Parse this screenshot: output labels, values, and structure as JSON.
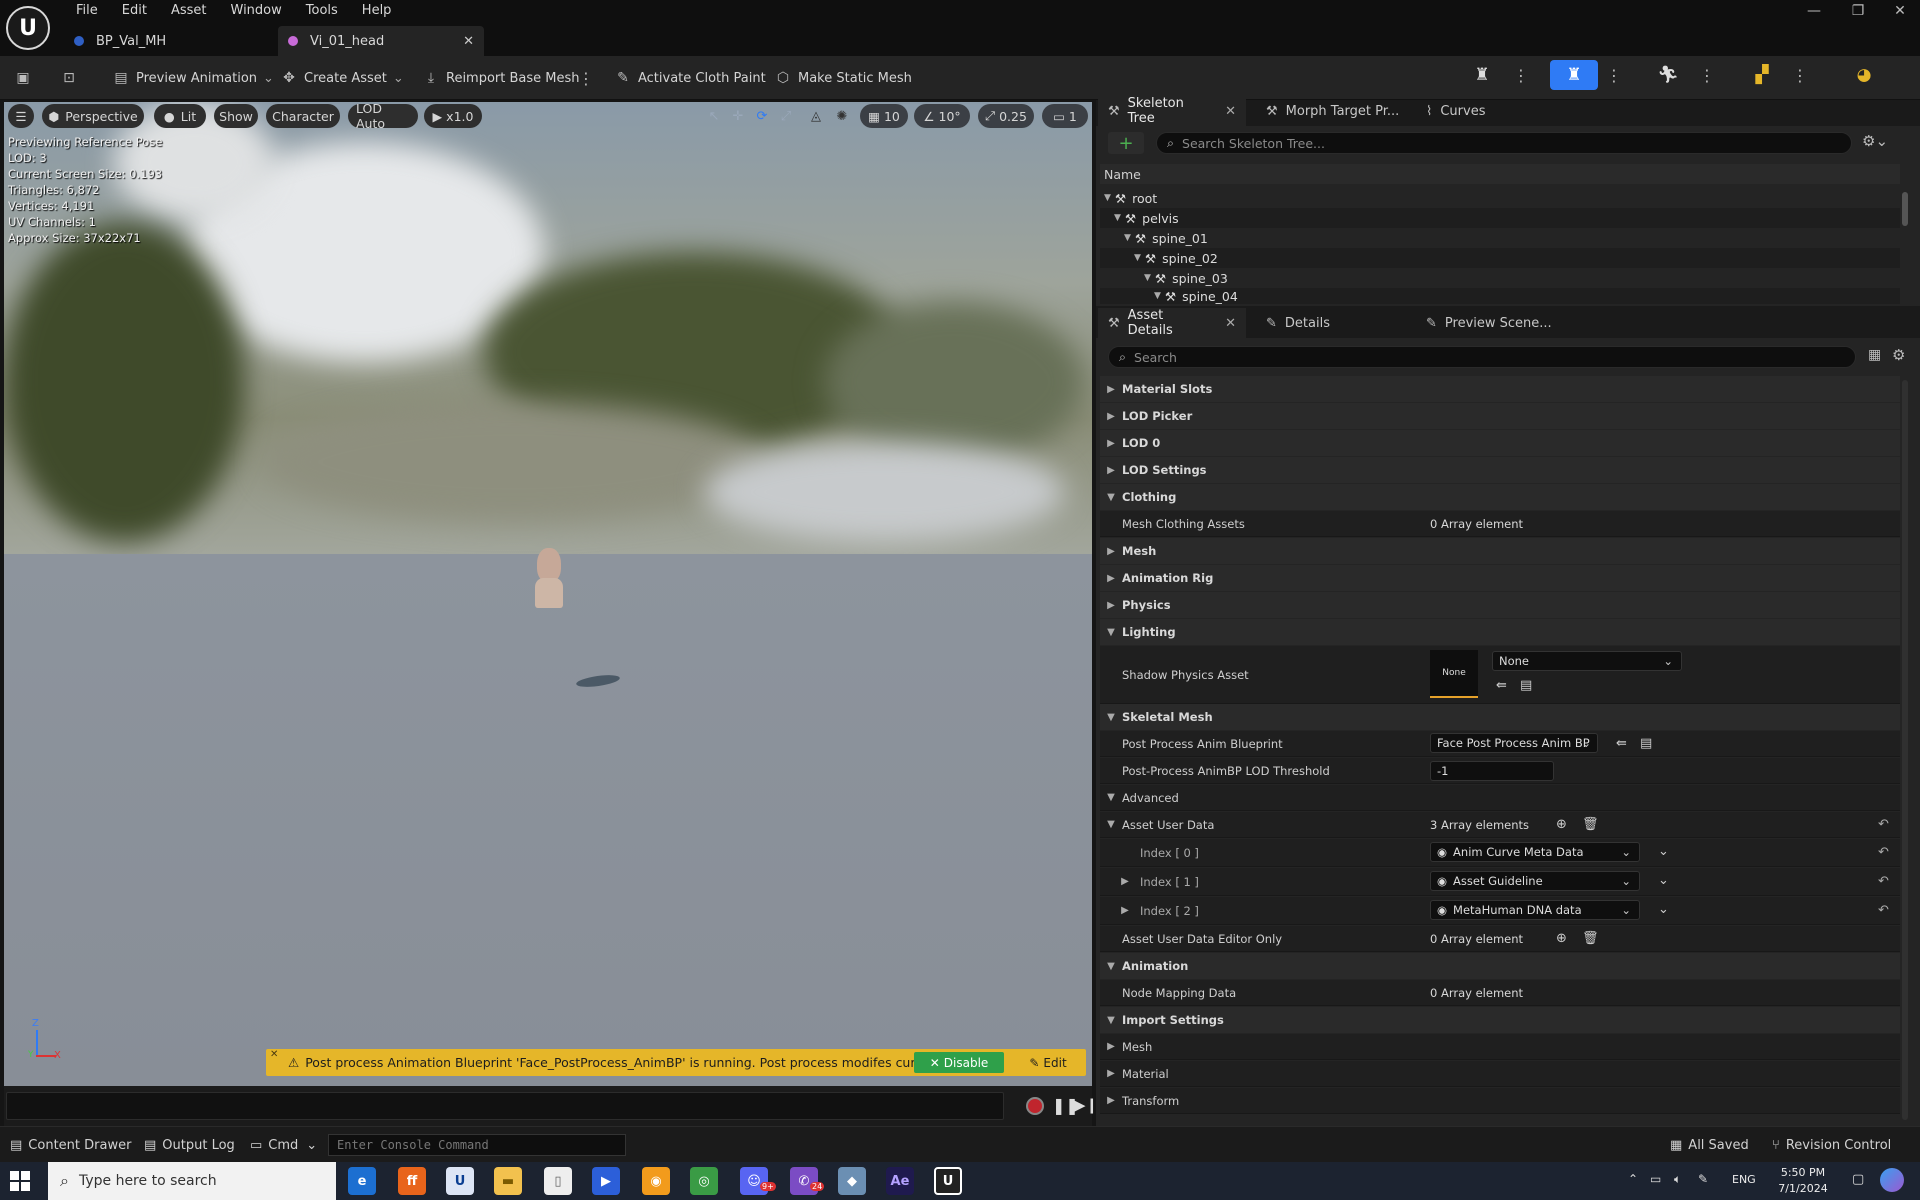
{
  "menu": [
    "File",
    "Edit",
    "Asset",
    "Window",
    "Tools",
    "Help"
  ],
  "tabs": [
    {
      "label": "BP_Val_MH"
    },
    {
      "label": "Vi_01_head",
      "close": "✕"
    }
  ],
  "toolbar": {
    "preview_animation": "Preview Animation",
    "create_asset": "Create Asset",
    "reimport": "Reimport Base Mesh",
    "cloth_paint": "Activate Cloth Paint",
    "static_mesh": "Make Static Mesh"
  },
  "viewport": {
    "perspective": "Perspective",
    "lit": "Lit",
    "show": "Show",
    "character": "Character",
    "lod": "LOD Auto",
    "speed": "x1.0",
    "grid": "10",
    "angle": "10°",
    "scale": "0.25",
    "camera": "1",
    "info": [
      "Previewing Reference Pose",
      "LOD: 3",
      "Current Screen Size: 0.193",
      "Triangles: 6,872",
      "Vertices: 4,191",
      "UV Channels: 1",
      "Approx Size: 37x22x71"
    ],
    "warning": "Post process Animation Blueprint 'Face_PostProcess_AnimBP' is running. Post process modifes curves.",
    "disable": "Disable",
    "edit": "Edit",
    "axis_z": "Z",
    "axis_y": "Y",
    "axis_x": "X"
  },
  "skeleton_panel": {
    "tabs": [
      "Skeleton Tree",
      "Morph Target Pr...",
      "Curves"
    ],
    "search_placeholder": "Search Skeleton Tree...",
    "column": "Name",
    "bones": [
      "root",
      "pelvis",
      "spine_01",
      "spine_02",
      "spine_03",
      "spine_04"
    ]
  },
  "details_panel": {
    "tabs": [
      "Asset Details",
      "Details",
      "Preview Scene..."
    ],
    "search_placeholder": "Search",
    "categories": {
      "material_slots": "Material Slots",
      "lod_picker": "LOD Picker",
      "lod0": "LOD 0",
      "lod_settings": "LOD Settings",
      "clothing": "Clothing",
      "mesh": "Mesh",
      "animation_rig": "Animation Rig",
      "physics": "Physics",
      "lighting": "Lighting",
      "skeletal_mesh": "Skeletal Mesh",
      "animation": "Animation",
      "import_settings": "Import Settings"
    },
    "rows": {
      "mesh_clothing_label": "Mesh Clothing Assets",
      "mesh_clothing_value": "0 Array element",
      "shadow_physics_label": "Shadow Physics Asset",
      "shadow_thumb": "None",
      "shadow_combo": "None",
      "post_process_label": "Post Process Anim Blueprint",
      "post_process_value": "Face Post Process Anim BP",
      "lod_threshold_label": "Post-Process AnimBP LOD Threshold",
      "lod_threshold_value": "-1",
      "advanced": "Advanced",
      "asset_user_data_label": "Asset User Data",
      "asset_user_data_value": "3 Array elements",
      "index0": "Index [ 0 ]",
      "index0_value": "Anim Curve Meta Data",
      "index1": "Index [ 1 ]",
      "index1_value": "Asset Guideline",
      "index2": "Index [ 2 ]",
      "index2_value": "MetaHuman DNA data",
      "editor_only_label": "Asset User Data Editor Only",
      "editor_only_value": "0 Array element",
      "node_mapping_label": "Node Mapping Data",
      "node_mapping_value": "0 Array element",
      "import_mesh": "Mesh",
      "import_material": "Material",
      "import_transform": "Transform"
    }
  },
  "statusbar": {
    "content_drawer": "Content Drawer",
    "output_log": "Output Log",
    "cmd": "Cmd",
    "console_placeholder": "Enter Console Command",
    "all_saved": "All Saved",
    "revision": "Revision Control"
  },
  "taskbar": {
    "search_placeholder": "Type here to search",
    "lang": "ENG",
    "time": "5:50 PM",
    "date": "7/1/2024",
    "badge_discord": "9+",
    "badge_viber": "24"
  },
  "colors": {
    "accent": "#2f7bf5",
    "warning": "#e5b629",
    "disable_green": "#2fa04a",
    "panel": "#1a1a1a"
  }
}
